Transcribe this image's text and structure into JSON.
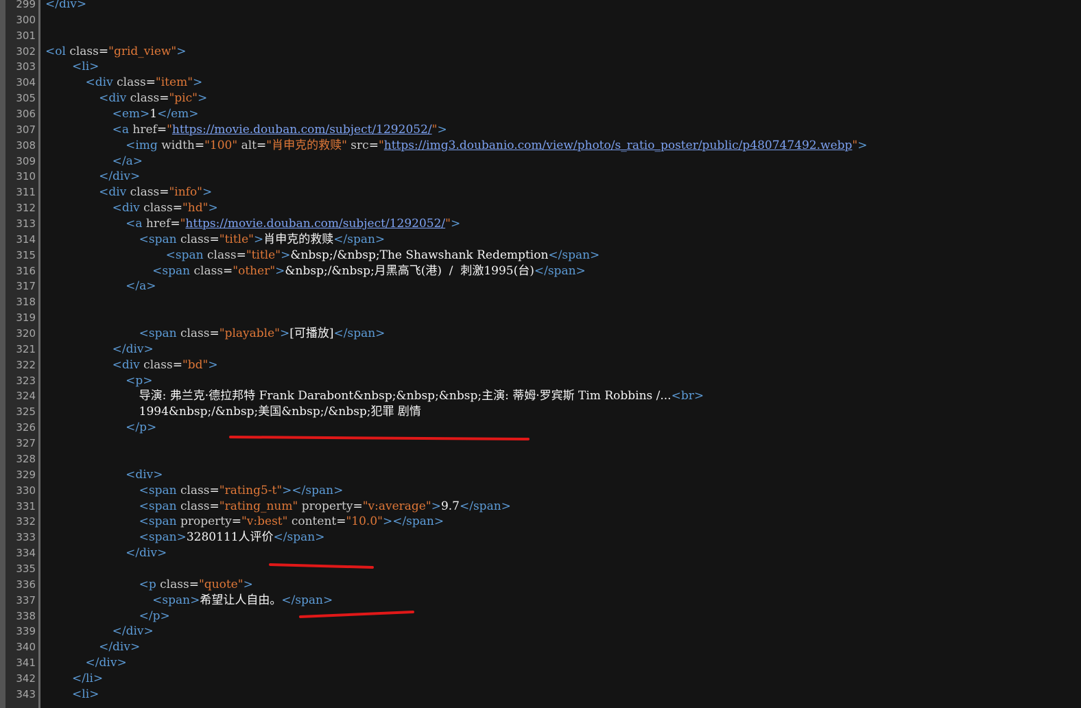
{
  "editor": {
    "lines": [
      {
        "n": "299",
        "indent": 0,
        "tokens": [
          {
            "c": "tag",
            "t": "</div>"
          }
        ]
      },
      {
        "n": "300",
        "indent": 0,
        "tokens": []
      },
      {
        "n": "301",
        "indent": 0,
        "tokens": []
      },
      {
        "n": "302",
        "indent": 0,
        "tokens": [
          {
            "c": "tag",
            "t": "<ol "
          },
          {
            "c": "attr",
            "t": "class"
          },
          {
            "c": "text",
            "t": "="
          },
          {
            "c": "val",
            "t": "\"grid_view\""
          },
          {
            "c": "tag",
            "t": ">"
          }
        ]
      },
      {
        "n": "303",
        "indent": 8,
        "tokens": [
          {
            "c": "tag",
            "t": "<li>"
          }
        ]
      },
      {
        "n": "304",
        "indent": 12,
        "tokens": [
          {
            "c": "tag",
            "t": "<div "
          },
          {
            "c": "attr",
            "t": "class"
          },
          {
            "c": "text",
            "t": "="
          },
          {
            "c": "val",
            "t": "\"item\""
          },
          {
            "c": "tag",
            "t": ">"
          }
        ]
      },
      {
        "n": "305",
        "indent": 16,
        "tokens": [
          {
            "c": "tag",
            "t": "<div "
          },
          {
            "c": "attr",
            "t": "class"
          },
          {
            "c": "text",
            "t": "="
          },
          {
            "c": "val",
            "t": "\"pic\""
          },
          {
            "c": "tag",
            "t": ">"
          }
        ]
      },
      {
        "n": "306",
        "indent": 20,
        "tokens": [
          {
            "c": "tag",
            "t": "<em>"
          },
          {
            "c": "text",
            "t": "1"
          },
          {
            "c": "tag",
            "t": "</em>"
          }
        ]
      },
      {
        "n": "307",
        "indent": 20,
        "tokens": [
          {
            "c": "tag",
            "t": "<a "
          },
          {
            "c": "attr",
            "t": "href"
          },
          {
            "c": "text",
            "t": "="
          },
          {
            "c": "val",
            "t": "\""
          },
          {
            "c": "link",
            "t": "https://movie.douban.com/subject/1292052/"
          },
          {
            "c": "val",
            "t": "\""
          },
          {
            "c": "tag",
            "t": ">"
          }
        ]
      },
      {
        "n": "308",
        "indent": 24,
        "tokens": [
          {
            "c": "tag",
            "t": "<img "
          },
          {
            "c": "attr",
            "t": "width"
          },
          {
            "c": "text",
            "t": "="
          },
          {
            "c": "val",
            "t": "\"100\""
          },
          {
            "c": "attr",
            "t": " alt"
          },
          {
            "c": "text",
            "t": "="
          },
          {
            "c": "val",
            "t": "\"肖申克的救赎\""
          },
          {
            "c": "attr",
            "t": " src"
          },
          {
            "c": "text",
            "t": "="
          },
          {
            "c": "val",
            "t": "\""
          },
          {
            "c": "link",
            "t": "https://img3.doubanio.com/view/photo/s_ratio_poster/public/p480747492.webp"
          },
          {
            "c": "val",
            "t": "\""
          },
          {
            "c": "tag",
            "t": ">"
          }
        ]
      },
      {
        "n": "309",
        "indent": 20,
        "tokens": [
          {
            "c": "tag",
            "t": "</a>"
          }
        ]
      },
      {
        "n": "310",
        "indent": 16,
        "tokens": [
          {
            "c": "tag",
            "t": "</div>"
          }
        ]
      },
      {
        "n": "311",
        "indent": 16,
        "tokens": [
          {
            "c": "tag",
            "t": "<div "
          },
          {
            "c": "attr",
            "t": "class"
          },
          {
            "c": "text",
            "t": "="
          },
          {
            "c": "val",
            "t": "\"info\""
          },
          {
            "c": "tag",
            "t": ">"
          }
        ]
      },
      {
        "n": "312",
        "indent": 20,
        "tokens": [
          {
            "c": "tag",
            "t": "<div "
          },
          {
            "c": "attr",
            "t": "class"
          },
          {
            "c": "text",
            "t": "="
          },
          {
            "c": "val",
            "t": "\"hd\""
          },
          {
            "c": "tag",
            "t": ">"
          }
        ]
      },
      {
        "n": "313",
        "indent": 24,
        "tokens": [
          {
            "c": "tag",
            "t": "<a "
          },
          {
            "c": "attr",
            "t": "href"
          },
          {
            "c": "text",
            "t": "="
          },
          {
            "c": "val",
            "t": "\""
          },
          {
            "c": "link",
            "t": "https://movie.douban.com/subject/1292052/"
          },
          {
            "c": "val",
            "t": "\""
          },
          {
            "c": "tag",
            "t": ">"
          }
        ]
      },
      {
        "n": "314",
        "indent": 28,
        "tokens": [
          {
            "c": "tag",
            "t": "<span "
          },
          {
            "c": "attr",
            "t": "class"
          },
          {
            "c": "text",
            "t": "="
          },
          {
            "c": "val",
            "t": "\"title\""
          },
          {
            "c": "tag",
            "t": ">"
          },
          {
            "c": "text",
            "t": "肖申克的救赎"
          },
          {
            "c": "tag",
            "t": "</span>"
          }
        ]
      },
      {
        "n": "315",
        "indent": 36,
        "tokens": [
          {
            "c": "tag",
            "t": "<span "
          },
          {
            "c": "attr",
            "t": "class"
          },
          {
            "c": "text",
            "t": "="
          },
          {
            "c": "val",
            "t": "\"title\""
          },
          {
            "c": "tag",
            "t": ">"
          },
          {
            "c": "text",
            "t": "&nbsp;/&nbsp;The Shawshank Redemption"
          },
          {
            "c": "tag",
            "t": "</span>"
          }
        ]
      },
      {
        "n": "316",
        "indent": 32,
        "tokens": [
          {
            "c": "tag",
            "t": "<span "
          },
          {
            "c": "attr",
            "t": "class"
          },
          {
            "c": "text",
            "t": "="
          },
          {
            "c": "val",
            "t": "\"other\""
          },
          {
            "c": "tag",
            "t": ">"
          },
          {
            "c": "text",
            "t": "&nbsp;/&nbsp;月黑高飞(港)  /  刺激1995(台)"
          },
          {
            "c": "tag",
            "t": "</span>"
          }
        ]
      },
      {
        "n": "317",
        "indent": 24,
        "tokens": [
          {
            "c": "tag",
            "t": "</a>"
          }
        ]
      },
      {
        "n": "318",
        "indent": 0,
        "tokens": []
      },
      {
        "n": "319",
        "indent": 0,
        "tokens": []
      },
      {
        "n": "320",
        "indent": 28,
        "tokens": [
          {
            "c": "tag",
            "t": "<span "
          },
          {
            "c": "attr",
            "t": "class"
          },
          {
            "c": "text",
            "t": "="
          },
          {
            "c": "val",
            "t": "\"playable\""
          },
          {
            "c": "tag",
            "t": ">"
          },
          {
            "c": "text",
            "t": "[可播放]"
          },
          {
            "c": "tag",
            "t": "</span>"
          }
        ]
      },
      {
        "n": "321",
        "indent": 20,
        "tokens": [
          {
            "c": "tag",
            "t": "</div>"
          }
        ]
      },
      {
        "n": "322",
        "indent": 20,
        "tokens": [
          {
            "c": "tag",
            "t": "<div "
          },
          {
            "c": "attr",
            "t": "class"
          },
          {
            "c": "text",
            "t": "="
          },
          {
            "c": "val",
            "t": "\"bd\""
          },
          {
            "c": "tag",
            "t": ">"
          }
        ]
      },
      {
        "n": "323",
        "indent": 24,
        "tokens": [
          {
            "c": "tag",
            "t": "<p>"
          }
        ]
      },
      {
        "n": "324",
        "indent": 28,
        "tokens": [
          {
            "c": "text",
            "t": "导演: 弗兰克·德拉邦特 Frank Darabont&nbsp;&nbsp;&nbsp;主演: 蒂姆·罗宾斯 Tim Robbins /..."
          },
          {
            "c": "tag",
            "t": "<br>"
          }
        ]
      },
      {
        "n": "325",
        "indent": 28,
        "tokens": [
          {
            "c": "text",
            "t": "1994&nbsp;/&nbsp;美国&nbsp;/&nbsp;犯罪 剧情"
          }
        ]
      },
      {
        "n": "326",
        "indent": 24,
        "tokens": [
          {
            "c": "tag",
            "t": "</p>"
          }
        ]
      },
      {
        "n": "327",
        "indent": 0,
        "tokens": []
      },
      {
        "n": "328",
        "indent": 0,
        "tokens": []
      },
      {
        "n": "329",
        "indent": 24,
        "tokens": [
          {
            "c": "tag",
            "t": "<div>"
          }
        ]
      },
      {
        "n": "330",
        "indent": 28,
        "tokens": [
          {
            "c": "tag",
            "t": "<span "
          },
          {
            "c": "attr",
            "t": "class"
          },
          {
            "c": "text",
            "t": "="
          },
          {
            "c": "val",
            "t": "\"rating5-t\""
          },
          {
            "c": "tag",
            "t": "></span>"
          }
        ]
      },
      {
        "n": "331",
        "indent": 28,
        "tokens": [
          {
            "c": "tag",
            "t": "<span "
          },
          {
            "c": "attr",
            "t": "class"
          },
          {
            "c": "text",
            "t": "="
          },
          {
            "c": "val",
            "t": "\"rating_num\""
          },
          {
            "c": "attr",
            "t": " property"
          },
          {
            "c": "text",
            "t": "="
          },
          {
            "c": "val",
            "t": "\"v:average\""
          },
          {
            "c": "tag",
            "t": ">"
          },
          {
            "c": "text",
            "t": "9.7"
          },
          {
            "c": "tag",
            "t": "</span>"
          }
        ]
      },
      {
        "n": "332",
        "indent": 28,
        "tokens": [
          {
            "c": "tag",
            "t": "<span "
          },
          {
            "c": "attr",
            "t": "property"
          },
          {
            "c": "text",
            "t": "="
          },
          {
            "c": "val",
            "t": "\"v:best\""
          },
          {
            "c": "attr",
            "t": " content"
          },
          {
            "c": "text",
            "t": "="
          },
          {
            "c": "val",
            "t": "\"10.0\""
          },
          {
            "c": "tag",
            "t": "></span>"
          }
        ]
      },
      {
        "n": "333",
        "indent": 28,
        "tokens": [
          {
            "c": "tag",
            "t": "<span>"
          },
          {
            "c": "text",
            "t": "3280111人评价"
          },
          {
            "c": "tag",
            "t": "</span>"
          }
        ]
      },
      {
        "n": "334",
        "indent": 24,
        "tokens": [
          {
            "c": "tag",
            "t": "</div>"
          }
        ]
      },
      {
        "n": "335",
        "indent": 0,
        "tokens": []
      },
      {
        "n": "336",
        "indent": 28,
        "tokens": [
          {
            "c": "tag",
            "t": "<p "
          },
          {
            "c": "attr",
            "t": "class"
          },
          {
            "c": "text",
            "t": "="
          },
          {
            "c": "val",
            "t": "\"quote\""
          },
          {
            "c": "tag",
            "t": ">"
          }
        ]
      },
      {
        "n": "337",
        "indent": 32,
        "tokens": [
          {
            "c": "tag",
            "t": "<span>"
          },
          {
            "c": "text",
            "t": "希望让人自由。"
          },
          {
            "c": "tag",
            "t": "</span>"
          }
        ]
      },
      {
        "n": "338",
        "indent": 28,
        "tokens": [
          {
            "c": "tag",
            "t": "</p>"
          }
        ]
      },
      {
        "n": "339",
        "indent": 20,
        "tokens": [
          {
            "c": "tag",
            "t": "</div>"
          }
        ]
      },
      {
        "n": "340",
        "indent": 16,
        "tokens": [
          {
            "c": "tag",
            "t": "</div>"
          }
        ]
      },
      {
        "n": "341",
        "indent": 12,
        "tokens": [
          {
            "c": "tag",
            "t": "</div>"
          }
        ]
      },
      {
        "n": "342",
        "indent": 8,
        "tokens": [
          {
            "c": "tag",
            "t": "</li>"
          }
        ]
      },
      {
        "n": "343",
        "indent": 8,
        "tokens": [
          {
            "c": "tag",
            "t": "<li>"
          }
        ]
      }
    ]
  },
  "annotations": {
    "color": "#e01818",
    "marks": [
      {
        "name": "underline-mark-genre"
      },
      {
        "name": "underline-mark-rating-count"
      },
      {
        "name": "underline-mark-quote"
      }
    ]
  }
}
